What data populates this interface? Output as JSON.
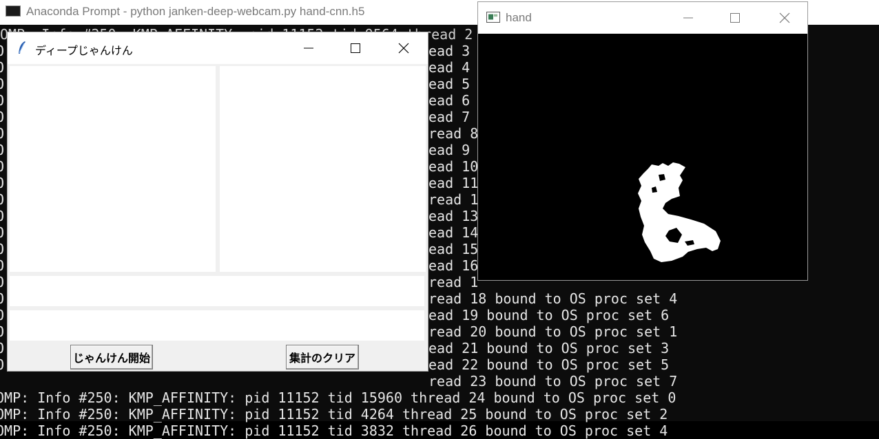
{
  "console": {
    "title": "Anaconda Prompt - python  janken-deep-webcam.py hand-cnn.h5",
    "overlap_line": "OMP: Info #250: KMP_AFFINITY: pid 11152 tid 9564 thread 2 bound to OS proc set 0",
    "left_column_char": "O",
    "column_lines": [
      "ead 3",
      "ead 4",
      "ead 5",
      "ead 6",
      "ead 7",
      "read 8",
      "ead 9",
      "ead 10",
      "ead 11",
      "read 1",
      "ead 13",
      "ead 14",
      "ead 15",
      "ead 16",
      "read 1"
    ],
    "right_lines": [
      "read 18 bound to OS proc set 4",
      "ead 19 bound to OS proc set 6",
      "read 20 bound to OS proc set 1",
      "ead 21 bound to OS proc set 3",
      "ead 22 bound to OS proc set 5",
      "read 23 bound to OS proc set 7"
    ],
    "full_lines": [
      "OMP: Info #250: KMP_AFFINITY: pid 11152 tid 15960 thread 24 bound to OS proc set 0",
      "OMP: Info #250: KMP_AFFINITY: pid 11152 tid 4264 thread 25 bound to OS proc set 2",
      "OMP: Info #250: KMP_AFFINITY: pid 11152 tid 3832 thread 26 bound to OS proc set 4"
    ]
  },
  "tk_window": {
    "title": "ディープじゃんけん",
    "start_button": "じゃんけん開始",
    "clear_button": "集計のクリア",
    "result_text": "",
    "stats_text": ""
  },
  "hand_window": {
    "title": "hand"
  },
  "colors": {
    "console_bg": "#0c0c0c",
    "console_text": "#e6e6e6",
    "tk_bg": "#f0f0f0",
    "hand_mask": "#ffffff"
  }
}
